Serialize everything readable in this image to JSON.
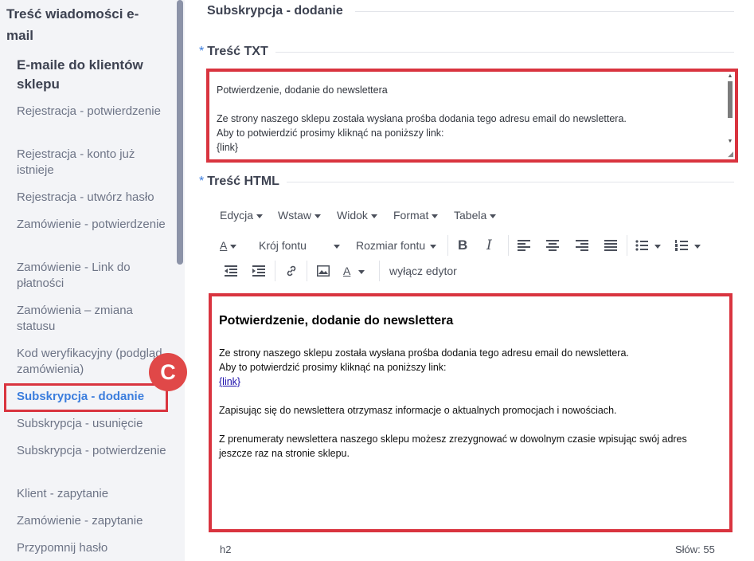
{
  "sidebar": {
    "title": "Treść wiadomości e-mail",
    "group": "E-maile do klientów sklepu",
    "items": [
      {
        "label": "Rejestracja - potwierdzenie"
      },
      {
        "label": "Rejestracja - konto już istnieje"
      },
      {
        "label": "Rejestracja - utwórz hasło"
      },
      {
        "label": "Zamówienie - potwierdzenie"
      },
      {
        "label": "Zamówienie - Link do płatności"
      },
      {
        "label": "Zamówienia – zmiana statusu"
      },
      {
        "label": "Kod weryfikacyjny (podgląd zamówienia)"
      },
      {
        "label": "Subskrypcja - dodanie"
      },
      {
        "label": "Subskrypcja - usunięcie"
      },
      {
        "label": "Subskrypcja - potwierdzenie"
      },
      {
        "label": "Klient - zapytanie"
      },
      {
        "label": "Zamówienie - zapytanie"
      },
      {
        "label": "Przypomnij hasło"
      }
    ],
    "active_index": 7,
    "badge": "C"
  },
  "header": {
    "title": "Subskrypcja - dodanie"
  },
  "txt_section": {
    "required_mark": "*",
    "label": "Treść TXT",
    "content": "Potwierdzenie, dodanie do newslettera\n\nZe strony naszego sklepu została wysłana prośba dodania tego adresu email do newslettera.\nAby to potwierdzić prosimy kliknąć na poniższy link:\n{link}"
  },
  "html_section": {
    "required_mark": "*",
    "label": "Treść HTML"
  },
  "editor": {
    "menus": [
      "Edycja",
      "Wstaw",
      "Widok",
      "Format",
      "Tabela"
    ],
    "font_family_label": "Krój fontu",
    "font_size_label": "Rozmiar fontu",
    "text_color_letter": "A",
    "toggle_editor_label": "wyłącz edytor",
    "content": {
      "heading": "Potwierdzenie, dodanie do newslettera",
      "p1_line1": "Ze strony naszego sklepu została wysłana prośba dodania tego adresu email do newslettera.",
      "p1_line2": "Aby to potwierdzić prosimy kliknąć na poniższy link:",
      "link": "{link}",
      "p2": "Zapisując się do newslettera otrzymasz informacje o aktualnych promocjach i nowościach.",
      "p3": "Z prenumeraty newslettera naszego sklepu możesz zrezygnować w dowolnym czasie wpisując swój adres jeszcze raz na stronie sklepu."
    },
    "status_element": "h2",
    "word_count": "Słów: 55"
  },
  "colors": {
    "accent": "#3b7ddd",
    "highlight": "#d9343f",
    "badge": "#e04848"
  }
}
